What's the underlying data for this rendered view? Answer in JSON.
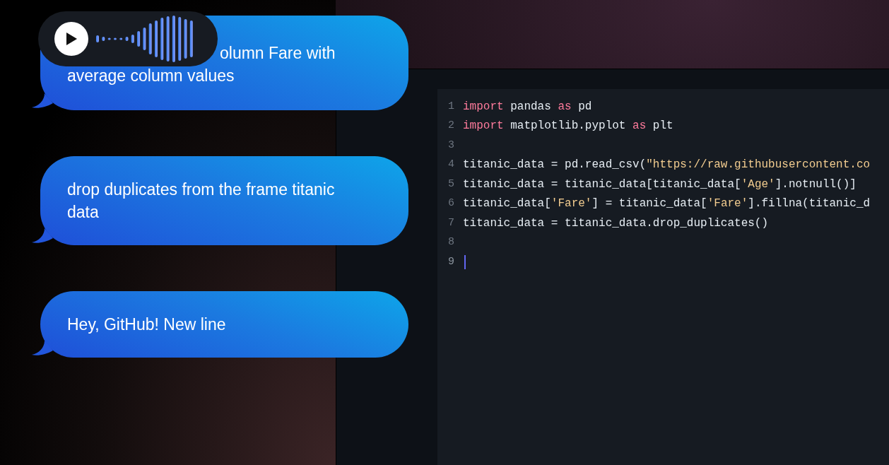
{
  "messages": [
    {
      "lines": [
        "olumn Fare with",
        "average column values"
      ],
      "voice_note": true
    },
    {
      "lines": [
        "drop duplicates from the frame titanic",
        "data"
      ],
      "voice_note": false
    },
    {
      "lines": [
        "Hey, GitHub! New line"
      ],
      "voice_note": false
    }
  ],
  "editor": {
    "lines": [
      {
        "number": "1",
        "cursor": false,
        "tokens": [
          {
            "kind": "keyword",
            "text": "import"
          },
          {
            "kind": "plain",
            "text": " pandas "
          },
          {
            "kind": "keyword",
            "text": "as"
          },
          {
            "kind": "plain",
            "text": " pd"
          }
        ]
      },
      {
        "number": "2",
        "cursor": false,
        "tokens": [
          {
            "kind": "keyword",
            "text": "import"
          },
          {
            "kind": "plain",
            "text": " matplotlib.pyplot "
          },
          {
            "kind": "keyword",
            "text": "as"
          },
          {
            "kind": "plain",
            "text": " plt"
          }
        ]
      },
      {
        "number": "3",
        "cursor": false
      },
      {
        "number": "4",
        "cursor": false,
        "tokens": [
          {
            "kind": "plain",
            "text": "titanic_data = pd.read_csv("
          },
          {
            "kind": "string",
            "text": "\"https://raw.githubusercontent.co"
          }
        ]
      },
      {
        "number": "5",
        "cursor": false,
        "tokens": [
          {
            "kind": "plain",
            "text": "titanic_data = titanic_data[titanic_data["
          },
          {
            "kind": "string",
            "text": "'Age'"
          },
          {
            "kind": "plain",
            "text": "].notnull()]"
          }
        ]
      },
      {
        "number": "6",
        "cursor": false,
        "tokens": [
          {
            "kind": "plain",
            "text": "titanic_data["
          },
          {
            "kind": "string",
            "text": "'Fare'"
          },
          {
            "kind": "plain",
            "text": "] = titanic_data["
          },
          {
            "kind": "string",
            "text": "'Fare'"
          },
          {
            "kind": "plain",
            "text": "].fillna(titanic_d"
          }
        ]
      },
      {
        "number": "7",
        "cursor": false,
        "tokens": [
          {
            "kind": "plain",
            "text": "titanic_data = titanic_data.drop_duplicates()"
          }
        ]
      },
      {
        "number": "8",
        "cursor": false
      },
      {
        "number": "9",
        "cursor": true
      }
    ]
  }
}
